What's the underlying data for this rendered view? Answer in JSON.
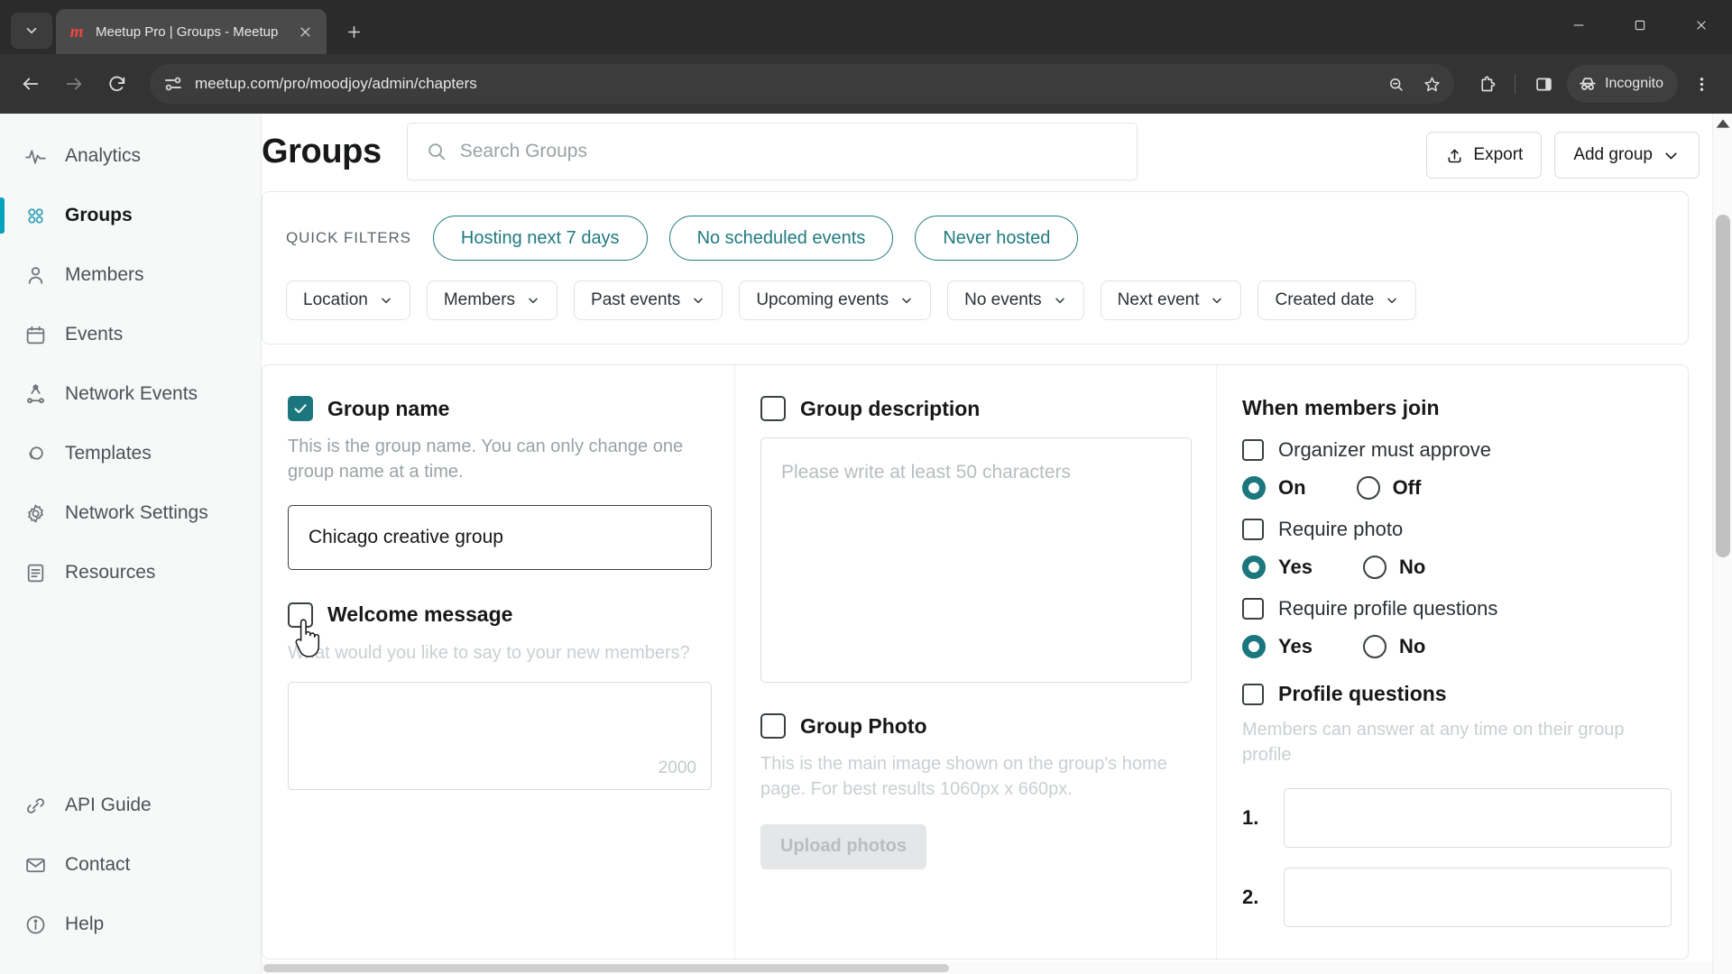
{
  "browser": {
    "tab": {
      "title": "Meetup Pro | Groups - Meetup",
      "favicon_letter": "m"
    },
    "new_tab_label": "+",
    "url": "meetup.com/pro/moodjoy/admin/chapters",
    "profile_label": "Incognito",
    "window_controls": {
      "minimize": "—",
      "maximize": "▢",
      "close": "✕"
    }
  },
  "sidebar": {
    "items": [
      {
        "label": "Analytics",
        "icon": "analytics-icon",
        "active": false
      },
      {
        "label": "Groups",
        "icon": "groups-grid-icon",
        "active": true
      },
      {
        "label": "Members",
        "icon": "person-icon",
        "active": false
      },
      {
        "label": "Events",
        "icon": "calendar-icon",
        "active": false
      },
      {
        "label": "Network Events",
        "icon": "network-icon",
        "active": false
      },
      {
        "label": "Templates",
        "icon": "templates-icon",
        "active": false
      },
      {
        "label": "Network Settings",
        "icon": "gear-icon",
        "active": false
      },
      {
        "label": "Resources",
        "icon": "document-list-icon",
        "active": false
      }
    ],
    "bottom_items": [
      {
        "label": "API Guide",
        "icon": "link-icon"
      },
      {
        "label": "Contact",
        "icon": "mail-icon"
      },
      {
        "label": "Help",
        "icon": "info-icon"
      }
    ]
  },
  "header": {
    "title": "Groups",
    "search_placeholder": "Search Groups",
    "export_label": "Export",
    "add_group_label": "Add group"
  },
  "filters": {
    "quick_filters_label": "QUICK FILTERS",
    "quick_filters": [
      "Hosting next 7 days",
      "No scheduled events",
      "Never hosted"
    ],
    "dropdowns": [
      "Location",
      "Members",
      "Past events",
      "Upcoming events",
      "No events",
      "Next event",
      "Created date"
    ]
  },
  "form": {
    "group_name": {
      "checkbox_label": "Group name",
      "checked": true,
      "helper": "This is the group name. You can only change one group name at a time.",
      "value": "Chicago creative group"
    },
    "welcome_message": {
      "checkbox_label": "Welcome message",
      "checked": false,
      "helper": "What would you like to say to your new members?",
      "value": "",
      "counter": "2000"
    },
    "group_description": {
      "checkbox_label": "Group description",
      "checked": false,
      "placeholder": "Please write at least 50 characters",
      "value": ""
    },
    "group_photo": {
      "checkbox_label": "Group Photo",
      "checked": false,
      "helper": "This is the main image shown on the group's home page. For best results 1060px x 660px.",
      "upload_label": "Upload photos"
    },
    "when_members_join": {
      "title": "When members join",
      "options": [
        {
          "checkbox_label": "Organizer must approve",
          "checked": false,
          "radios": [
            {
              "label": "On",
              "selected": true
            },
            {
              "label": "Off",
              "selected": false
            }
          ]
        },
        {
          "checkbox_label": "Require photo",
          "checked": false,
          "radios": [
            {
              "label": "Yes",
              "selected": true
            },
            {
              "label": "No",
              "selected": false
            }
          ]
        },
        {
          "checkbox_label": "Require profile questions",
          "checked": false,
          "radios": [
            {
              "label": "Yes",
              "selected": true
            },
            {
              "label": "No",
              "selected": false
            }
          ]
        }
      ]
    },
    "profile_questions": {
      "checkbox_label": "Profile questions",
      "checked": false,
      "helper": "Members can answer at any time on their group profile",
      "items": [
        {
          "number": "1.",
          "value": ""
        },
        {
          "number": "2.",
          "value": ""
        }
      ]
    }
  },
  "colors": {
    "accent_teal": "#1b777d",
    "active_cyan": "#00A2BE",
    "chip_border": "#1f7a7f",
    "brand_red": "#f0463c"
  }
}
